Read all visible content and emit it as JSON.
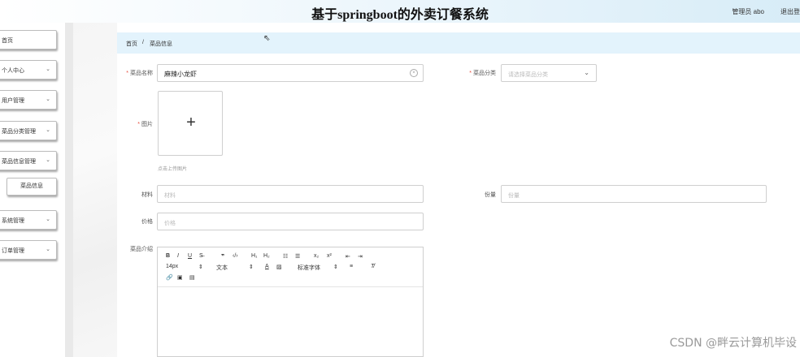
{
  "header": {
    "title": "基于springboot的外卖订餐系统",
    "user": "管理员 abo",
    "logout": "退出登录"
  },
  "sidebar": {
    "items": [
      {
        "label": "首页",
        "chevron": false
      },
      {
        "label": "个人中心",
        "chevron": true
      },
      {
        "label": "用户管理",
        "chevron": true
      },
      {
        "label": "菜品分类管理",
        "chevron": true
      },
      {
        "label": "菜品信息管理",
        "chevron": true
      },
      {
        "label": "系统管理",
        "chevron": true
      },
      {
        "label": "订单管理",
        "chevron": true
      }
    ],
    "active_sub": "菜品信息"
  },
  "breadcrumb": {
    "home": "首页",
    "separator": "/",
    "current": "菜品信息"
  },
  "form": {
    "name_label": "菜品名称",
    "name_value": "麻辣小龙虾",
    "category_label": "菜品分类",
    "category_placeholder": "请选择菜品分类",
    "image_label": "图片",
    "upload_tip": "点击上传图片",
    "material_label": "材料",
    "material_placeholder": "材料",
    "weight_label": "份量",
    "weight_placeholder": "份量",
    "price_label": "价格",
    "price_placeholder": "价格",
    "intro_label": "菜品介绍"
  },
  "editor": {
    "font_size": "14px",
    "text_style": "文本",
    "font_family": "标准字体"
  },
  "watermark": "CSDN @畔云计算机毕设"
}
